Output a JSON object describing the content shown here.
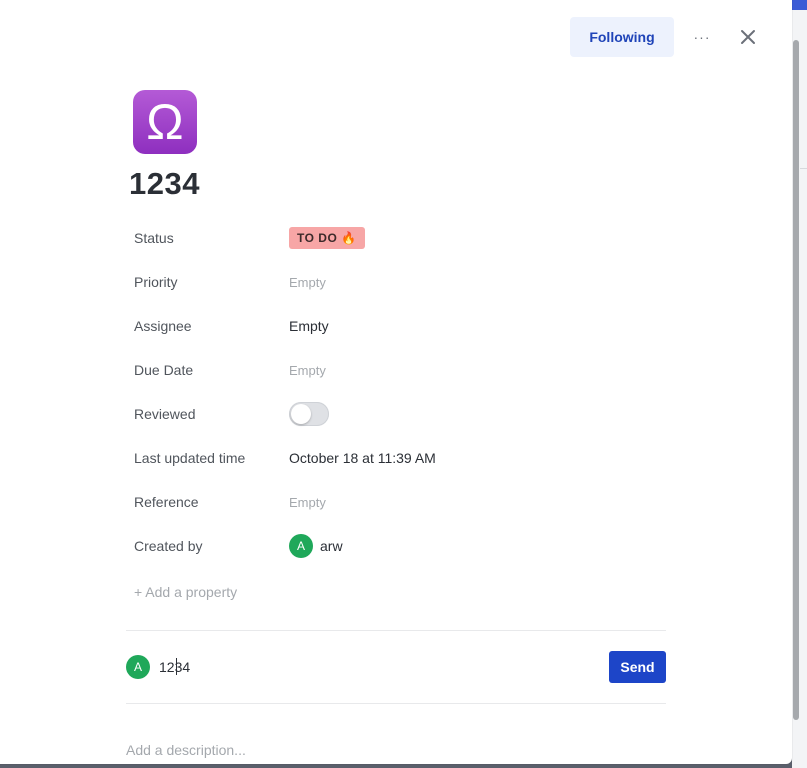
{
  "header": {
    "following_label": "Following",
    "more_label": "···"
  },
  "page": {
    "icon_glyph": "Ω",
    "icon_name": "libra-icon",
    "title": "1234"
  },
  "properties": [
    {
      "label": "Status",
      "value": "TO DO",
      "type": "status",
      "emoji": "🔥"
    },
    {
      "label": "Priority",
      "value": "Empty",
      "type": "empty"
    },
    {
      "label": "Assignee",
      "value": "Empty",
      "type": "text"
    },
    {
      "label": "Due Date",
      "value": "Empty",
      "type": "empty"
    },
    {
      "label": "Reviewed",
      "value": false,
      "type": "toggle"
    },
    {
      "label": "Last updated time",
      "value": "October 18 at 11:39 AM",
      "type": "text"
    },
    {
      "label": "Reference",
      "value": "Empty",
      "type": "empty"
    },
    {
      "label": "Created by",
      "value": "arw",
      "type": "person",
      "avatar_initial": "A"
    }
  ],
  "add_property_label": "+ Add a property",
  "comment": {
    "avatar_initial": "A",
    "text_before_caret": "12",
    "text_after_caret": "34",
    "send_label": "Send"
  },
  "description_placeholder": "Add a description...",
  "colors": {
    "accent": "#1d45c8",
    "status_bg": "#f7a6a6",
    "avatar": "#1fa85a",
    "page_icon": "#9b3fc9"
  }
}
